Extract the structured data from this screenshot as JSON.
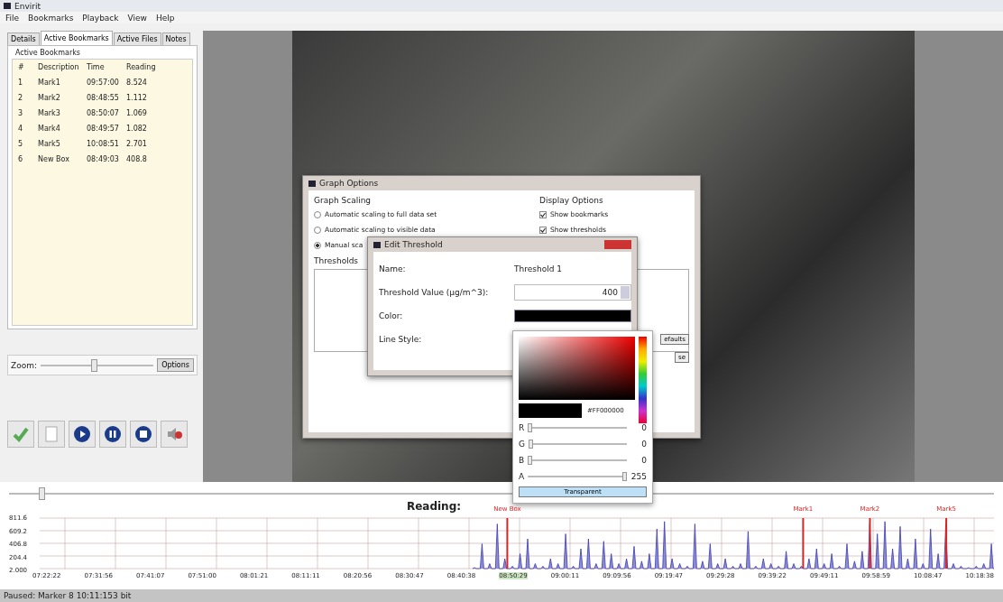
{
  "window": {
    "title": "Envirit"
  },
  "menu": [
    "File",
    "Bookmarks",
    "Playback",
    "View",
    "Help"
  ],
  "tabs": [
    {
      "label": "Details",
      "selected": false
    },
    {
      "label": "Active Bookmarks",
      "selected": true
    },
    {
      "label": "Active Files",
      "selected": false
    },
    {
      "label": "Notes",
      "selected": false
    }
  ],
  "bookmarks": {
    "title": "Active Bookmarks",
    "columns": [
      "#",
      "Description",
      "Time",
      "Reading"
    ],
    "rows": [
      [
        "1",
        "Mark1",
        "09:57:00",
        "8.524"
      ],
      [
        "2",
        "Mark2",
        "08:48:55",
        "1.112"
      ],
      [
        "3",
        "Mark3",
        "08:50:07",
        "1.069"
      ],
      [
        "4",
        "Mark4",
        "08:49:57",
        "1.082"
      ],
      [
        "5",
        "Mark5",
        "10:08:51",
        "2.701"
      ],
      [
        "6",
        "New Box",
        "08:49:03",
        "408.8"
      ]
    ]
  },
  "zoom": {
    "label": "Zoom:",
    "level": 0.47,
    "button": "Options"
  },
  "graph_options": {
    "title": "Graph Options",
    "scaling_title": "Graph Scaling",
    "scaling": [
      {
        "label": "Automatic scaling to full data set",
        "selected": false
      },
      {
        "label": "Automatic scaling to visible data",
        "selected": false
      },
      {
        "label": "Manual sca",
        "selected": true
      }
    ],
    "display_title": "Display Options",
    "display": [
      {
        "label": "Show bookmarks",
        "checked": true
      },
      {
        "label": "Show thresholds",
        "checked": true
      }
    ],
    "thresholds_title": "Thresholds",
    "buttons": [
      "efaults",
      "se"
    ]
  },
  "edit_threshold": {
    "title": "Edit Threshold",
    "fields": [
      {
        "kind": "text",
        "label": "Name:",
        "value": "Threshold 1"
      },
      {
        "kind": "spin",
        "label": "Threshold Value (µg/m^3):",
        "value": "400"
      },
      {
        "kind": "color",
        "label": "Color:",
        "color": "#000000"
      },
      {
        "kind": "empty",
        "label": "Line Style:"
      }
    ]
  },
  "color_picker": {
    "hex": "#FF000000",
    "channels": [
      {
        "label": "R",
        "value": "0",
        "level": 0
      },
      {
        "label": "G",
        "value": "0",
        "level": 0
      },
      {
        "label": "B",
        "value": "0",
        "level": 0
      },
      {
        "label": "A",
        "value": "255",
        "level": 1
      }
    ],
    "button": "Transparent"
  },
  "timeline": {
    "level": 0.03
  },
  "reading": "Reading:",
  "graph": {
    "y_labels": [
      "811.6",
      "609.2",
      "406.8",
      "204.4",
      "2.000"
    ],
    "x_labels": [
      {
        "label": "07:22:22",
        "selected": false
      },
      {
        "label": "07:31:56",
        "selected": false
      },
      {
        "label": "07:41:07",
        "selected": false
      },
      {
        "label": "07:51:00",
        "selected": false
      },
      {
        "label": "08:01:21",
        "selected": false
      },
      {
        "label": "08:11:11",
        "selected": false
      },
      {
        "label": "08:20:56",
        "selected": false
      },
      {
        "label": "08:30:47",
        "selected": false
      },
      {
        "label": "08:40:38",
        "selected": false
      },
      {
        "label": "08:50:29",
        "selected": true
      },
      {
        "label": "09:00:11",
        "selected": false
      },
      {
        "label": "09:09:56",
        "selected": false
      },
      {
        "label": "09:19:47",
        "selected": false
      },
      {
        "label": "09:29:28",
        "selected": false
      },
      {
        "label": "09:39:22",
        "selected": false
      },
      {
        "label": "09:49:11",
        "selected": false
      },
      {
        "label": "09:58:59",
        "selected": false
      },
      {
        "label": "10:08:47",
        "selected": false
      },
      {
        "label": "10:18:38",
        "selected": false
      }
    ],
    "markers": [
      {
        "label": "New Box"
      },
      {
        "label": "Mark1"
      },
      {
        "label": "Mark2"
      },
      {
        "label": "Mark5"
      }
    ]
  },
  "status": "Paused: Marker 8 10:11:153 bit"
}
